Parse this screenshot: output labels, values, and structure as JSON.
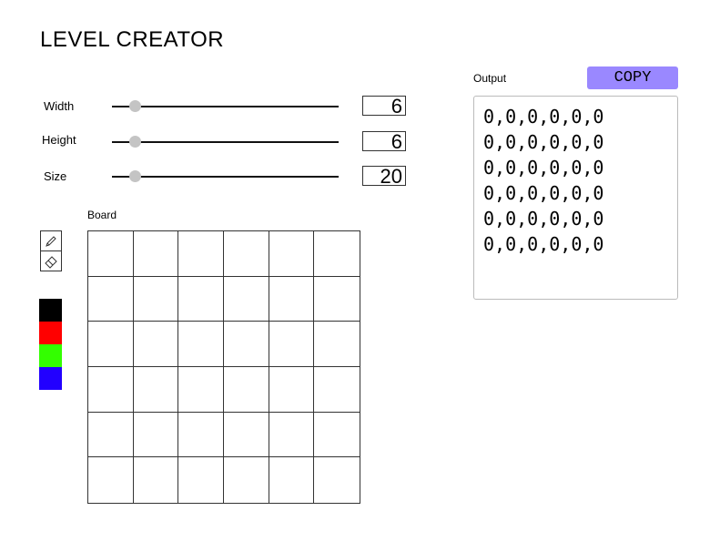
{
  "title": "LEVEL CREATOR",
  "sliders": [
    {
      "label": "Width",
      "value": "6",
      "fraction": 0.1
    },
    {
      "label": "Height",
      "value": "6",
      "fraction": 0.1
    },
    {
      "label": "Size",
      "value": "20",
      "fraction": 0.1
    }
  ],
  "board": {
    "label": "Board",
    "columns": 6,
    "rows": 6
  },
  "tools": [
    {
      "name": "pencil-icon"
    },
    {
      "name": "eraser-icon"
    }
  ],
  "palette": [
    "#000000",
    "#ff0000",
    "#33ff00",
    "#2200ff"
  ],
  "output": {
    "label": "Output",
    "copy_label": "COPY",
    "lines": [
      "0,0,0,0,0,0",
      "0,0,0,0,0,0",
      "0,0,0,0,0,0",
      "0,0,0,0,0,0",
      "0,0,0,0,0,0",
      "0,0,0,0,0,0"
    ]
  },
  "colors": {
    "copy_button": "#9a88ff"
  }
}
